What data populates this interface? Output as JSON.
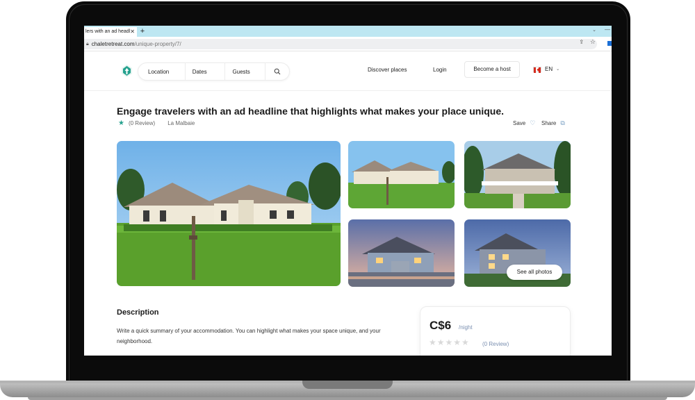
{
  "browser": {
    "tab_title": "lers with an ad headl",
    "tab_close": "✕",
    "new_tab": "+",
    "url_host": "chaletretreat.com",
    "url_path": "/unique-property/7/"
  },
  "header": {
    "search": {
      "location": "Location",
      "dates": "Dates",
      "guests": "Guests"
    },
    "nav": {
      "discover": "Discover places",
      "login": "Login",
      "become_host": "Become a host"
    },
    "language": "EN"
  },
  "listing": {
    "title": "Engage travelers with an ad headline that highlights what makes your place unique.",
    "reviews": "(0 Review)",
    "location": "La Malbaie",
    "save_label": "Save",
    "share_label": "Share",
    "see_all_photos": "See all photos"
  },
  "description": {
    "heading": "Description",
    "body": "Write a quick summary of your accommodation. You can highlight what makes your space unique, and your neighborhood."
  },
  "booking": {
    "price": "C$6",
    "per": "/night",
    "rating": 0,
    "rating_max": 5,
    "reviews": "(0 Review)"
  },
  "colors": {
    "accent": "#25a18e",
    "tab_bar": "#bde7f2",
    "muted_blue": "#7a8fb0"
  }
}
